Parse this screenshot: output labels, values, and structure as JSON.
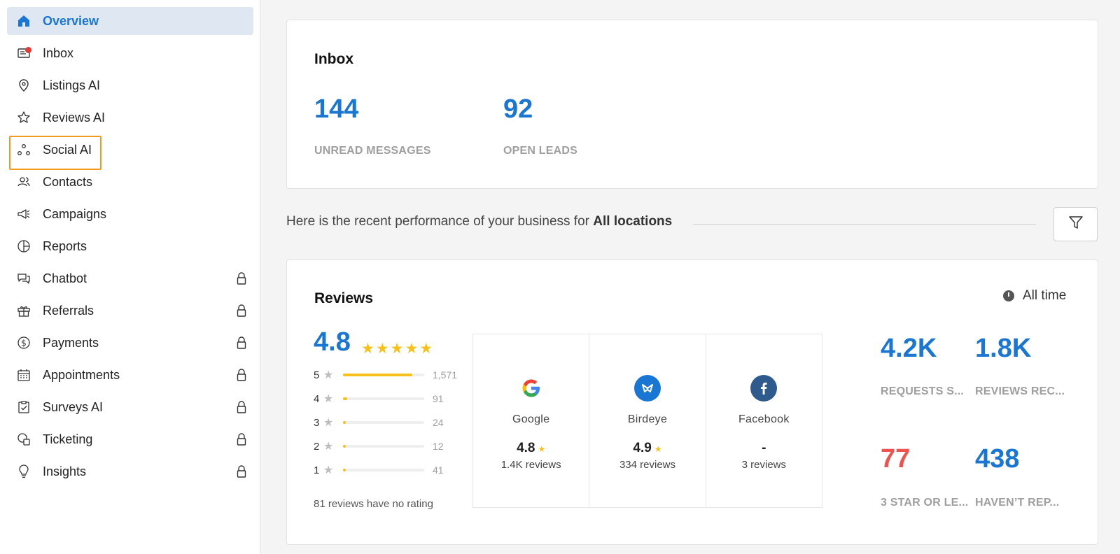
{
  "sidebar": {
    "items": [
      {
        "label": "Overview",
        "icon": "home-icon",
        "active": true,
        "locked": false
      },
      {
        "label": "Inbox",
        "icon": "inbox-icon",
        "active": false,
        "locked": false
      },
      {
        "label": "Listings AI",
        "icon": "location-pin-icon",
        "active": false,
        "locked": false
      },
      {
        "label": "Reviews AI",
        "icon": "star-icon",
        "active": false,
        "locked": false
      },
      {
        "label": "Social AI",
        "icon": "social-nodes-icon",
        "active": false,
        "locked": false
      },
      {
        "label": "Contacts",
        "icon": "contacts-icon",
        "active": false,
        "locked": false
      },
      {
        "label": "Campaigns",
        "icon": "megaphone-icon",
        "active": false,
        "locked": false
      },
      {
        "label": "Reports",
        "icon": "pie-chart-icon",
        "active": false,
        "locked": false
      },
      {
        "label": "Chatbot",
        "icon": "chat-bubbles-icon",
        "active": false,
        "locked": true
      },
      {
        "label": "Referrals",
        "icon": "gift-icon",
        "active": false,
        "locked": true
      },
      {
        "label": "Payments",
        "icon": "dollar-icon",
        "active": false,
        "locked": true
      },
      {
        "label": "Appointments",
        "icon": "calendar-icon",
        "active": false,
        "locked": true
      },
      {
        "label": "Surveys AI",
        "icon": "checklist-icon",
        "active": false,
        "locked": true
      },
      {
        "label": "Ticketing",
        "icon": "ticket-icon",
        "active": false,
        "locked": true
      },
      {
        "label": "Insights",
        "icon": "lightbulb-icon",
        "active": false,
        "locked": true
      }
    ]
  },
  "inbox": {
    "title": "Inbox",
    "unread_count": "144",
    "unread_label": "UNREAD MESSAGES",
    "leads_count": "92",
    "leads_label": "OPEN LEADS"
  },
  "performance": {
    "prefix": "Here is the recent performance of your business for",
    "location": "All locations"
  },
  "reviews": {
    "title": "Reviews",
    "time_filter": "All time",
    "average": "4.8",
    "stars": "★★★★★",
    "histogram": [
      {
        "stars": "5",
        "count": "1,571",
        "fraction": 0.85
      },
      {
        "stars": "4",
        "count": "91",
        "fraction": 0.05
      },
      {
        "stars": "3",
        "count": "24",
        "fraction": 0.015
      },
      {
        "stars": "2",
        "count": "12",
        "fraction": 0.008
      },
      {
        "stars": "1",
        "count": "41",
        "fraction": 0.02
      }
    ],
    "no_rating_text": "81 reviews have no rating",
    "sources": [
      {
        "name": "Google",
        "rating": "4.8",
        "has_star": true,
        "count": "1.4K reviews",
        "icon": "google-icon"
      },
      {
        "name": "Birdeye",
        "rating": "4.9",
        "has_star": true,
        "count": "334 reviews",
        "icon": "birdeye-icon"
      },
      {
        "name": "Facebook",
        "rating": "-",
        "has_star": false,
        "count": "3 reviews",
        "icon": "facebook-icon"
      }
    ],
    "stats": [
      {
        "value": "4.2K",
        "label": "REQUESTS S...",
        "color": "#1976d2"
      },
      {
        "value": "1.8K",
        "label": "REVIEWS REC...",
        "color": "#1976d2"
      },
      {
        "value": "77",
        "label": "3 STAR OR LE...",
        "color": "#ef5350"
      },
      {
        "value": "438",
        "label": "HAVEN’T REP...",
        "color": "#1976d2"
      }
    ]
  },
  "colors": {
    "accent": "#1976d2",
    "star": "#f6c21a",
    "highlight": "#f39a1e",
    "negative": "#ef5350"
  }
}
